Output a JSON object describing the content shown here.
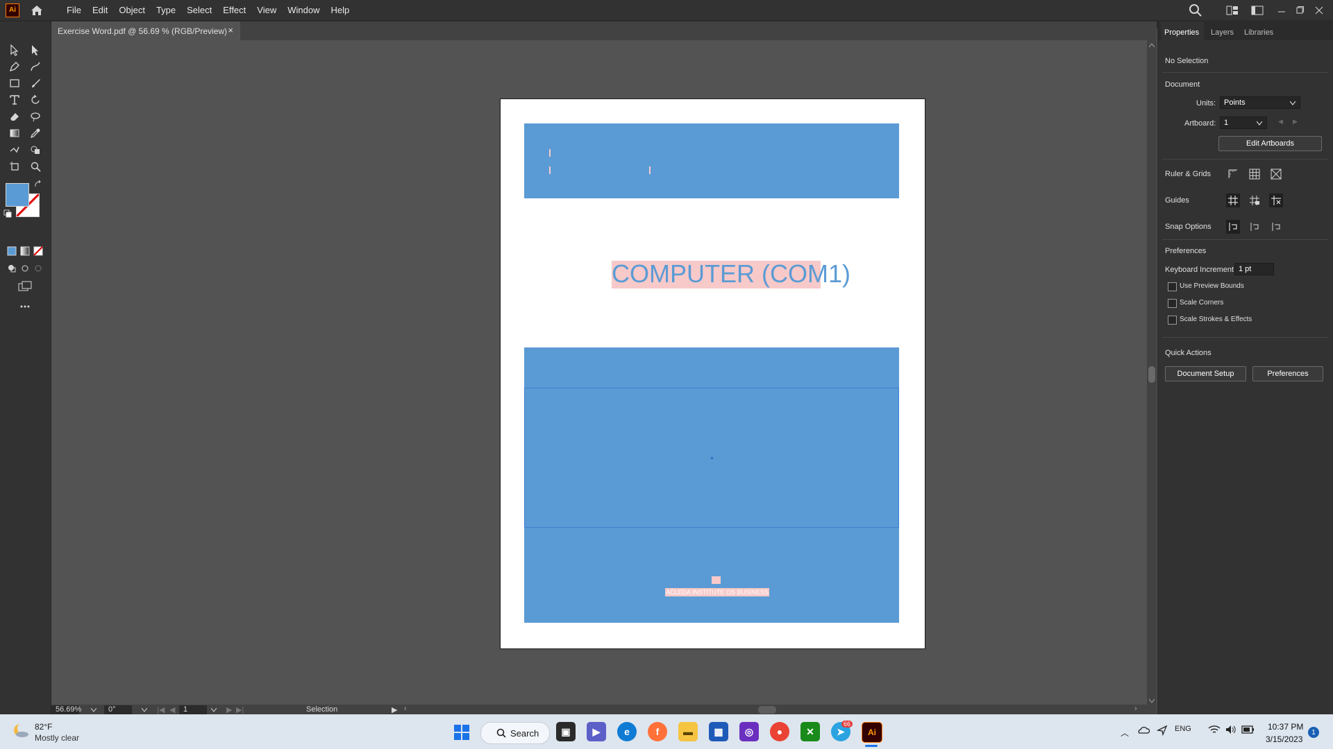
{
  "app": {
    "logo": "Ai",
    "menus": [
      "File",
      "Edit",
      "Object",
      "Type",
      "Select",
      "Effect",
      "View",
      "Window",
      "Help"
    ]
  },
  "document": {
    "tab_title": "Exercise Word.pdf @ 56.69 % (RGB/Preview)",
    "close_glyph": "×"
  },
  "artboard_content": {
    "title": "COMPUTER (COM1)",
    "footer_text": "ACLEDA INSTITUTE OS BUSINESS",
    "accent": "#5b9bd5",
    "highlight": "#f7c9c9"
  },
  "status": {
    "zoom": "56.69%",
    "rotation": "0°",
    "artboard_nav": "1",
    "tool": "Selection"
  },
  "panel": {
    "tabs": [
      "Properties",
      "Layers",
      "Libraries"
    ],
    "selection": "No Selection",
    "document_header": "Document",
    "units_label": "Units:",
    "units_value": "Points",
    "artboard_label": "Artboard:",
    "artboard_value": "1",
    "edit_artboards": "Edit Artboards",
    "ruler_grids": "Ruler & Grids",
    "guides": "Guides",
    "snap_options": "Snap Options",
    "preferences_header": "Preferences",
    "keyboard_increment_label": "Keyboard Increment:",
    "keyboard_increment_value": "1 pt",
    "use_preview_bounds": "Use Preview Bounds",
    "scale_corners": "Scale Corners",
    "scale_strokes": "Scale Strokes & Effects",
    "quick_actions": "Quick Actions",
    "document_setup": "Document Setup",
    "preferences_button": "Preferences"
  },
  "taskbar": {
    "weather_temp": "82°F",
    "weather_desc": "Mostly clear",
    "search_label": "Search",
    "time": "10:37 PM",
    "date": "3/15/2023",
    "telegram_badge": "66",
    "notification_count": "1"
  }
}
